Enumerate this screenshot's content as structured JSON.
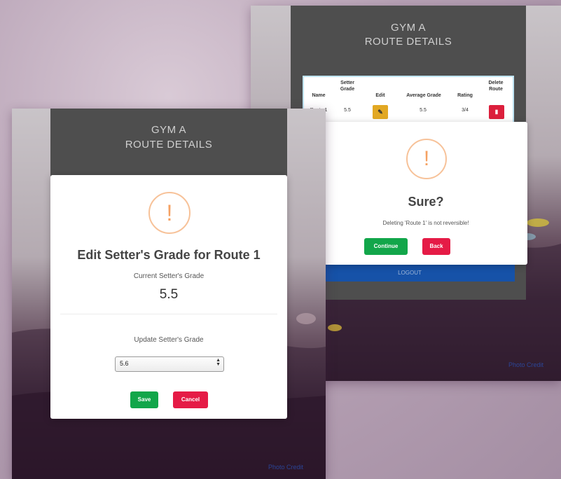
{
  "back_screen": {
    "panel": {
      "title_line1": "GYM A",
      "title_line2": "ROUTE DETAILS"
    },
    "table": {
      "headers": [
        "Name",
        "Setter Grade",
        "Edit",
        "Average Grade",
        "Rating",
        "Delete Route"
      ],
      "row": {
        "name": "Route 1",
        "setter_grade": "5.5",
        "average_grade": "5.5",
        "rating": "3/4"
      },
      "edit_icon": "edit-icon",
      "delete_icon": "trash-icon"
    },
    "modal": {
      "icon_glyph": "!",
      "title": "Sure?",
      "message": "Deleting 'Route 1' is not reversible!",
      "continue_label": "Continue",
      "back_label": "Back"
    },
    "logout_label": "LOGOUT",
    "photo_credit": "Photo Credit"
  },
  "front_screen": {
    "panel": {
      "title_line1": "GYM A",
      "title_line2": "ROUTE DETAILS"
    },
    "modal": {
      "icon_glyph": "!",
      "title": "Edit Setter's Grade for Route 1",
      "current_label": "Current Setter's Grade",
      "current_value": "5.5",
      "update_label": "Update Setter's Grade",
      "select_value": "5.6",
      "save_label": "Save",
      "cancel_label": "Cancel"
    },
    "photo_credit": "Photo Credit"
  },
  "colors": {
    "panel": "#4e4e4e",
    "warning": "#f5a162",
    "green_button": "#12a64a",
    "red_button": "#e51b46",
    "edit_button": "#e2a823",
    "logout_bar": "#1652a8"
  }
}
